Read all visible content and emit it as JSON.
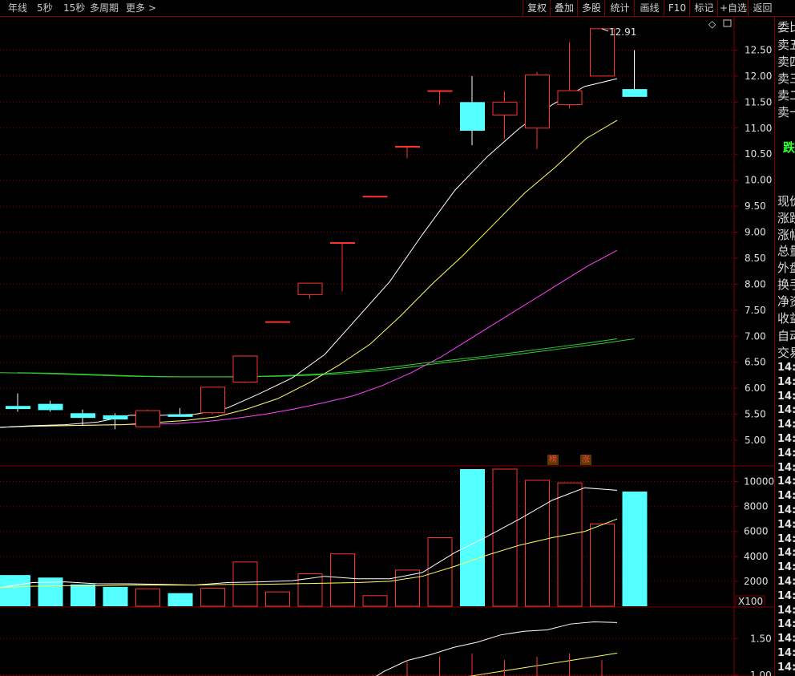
{
  "toolbar": {
    "left_tabs": [
      "年线",
      "5秒",
      "15秒",
      "多周期",
      "更多 >"
    ],
    "right_buttons": [
      "复权",
      "叠加",
      "多股",
      "统计",
      "画线",
      "F10",
      "标记",
      "+自选",
      "返回"
    ]
  },
  "right_panel": {
    "labels": [
      "委比",
      "卖五",
      "卖四",
      "卖三",
      "卖二",
      "卖一"
    ],
    "status": "跌",
    "stats": [
      "现价",
      "涨跌",
      "涨幅",
      "总量",
      "外盘",
      "换手",
      "净资",
      "收益"
    ],
    "extra": [
      "自动",
      "交易"
    ],
    "times": [
      "14:",
      "14:",
      "14:",
      "14:",
      "14:",
      "14:",
      "14:",
      "14:",
      "14:",
      "14:",
      "14:",
      "14:",
      "14:",
      "14:",
      "14:",
      "14:",
      "14:",
      "14:",
      "14:",
      "14:",
      "14:",
      "14:",
      "14:"
    ]
  },
  "badges": [
    "榜",
    "涨"
  ],
  "colors": {
    "up": "#ff3232",
    "down": "#54ffff",
    "ma5": "#ffffff",
    "ma10": "#ffff66",
    "ma20": "#ff44ff",
    "ma60": "#33cc33",
    "grid": "#800000"
  },
  "chart_data": [
    {
      "type": "candlestick",
      "ylim": [
        4.6,
        13.0
      ],
      "yticks": [
        "12.50",
        "12.00",
        "11.50",
        "11.00",
        "10.50",
        "10.00",
        "9.50",
        "9.00",
        "8.50",
        "8.00",
        "7.50",
        "7.00",
        "6.50",
        "6.00",
        "5.50",
        "5.00"
      ],
      "max_label": "12.91",
      "candles": [
        {
          "o": 5.66,
          "h": 5.9,
          "l": 5.55,
          "c": 5.6
        },
        {
          "o": 5.7,
          "h": 5.76,
          "l": 5.55,
          "c": 5.58
        },
        {
          "o": 5.52,
          "h": 5.59,
          "l": 5.28,
          "c": 5.43
        },
        {
          "o": 5.48,
          "h": 5.52,
          "l": 5.21,
          "c": 5.4
        },
        {
          "o": 5.26,
          "h": 5.59,
          "l": 5.26,
          "c": 5.57
        },
        {
          "o": 5.5,
          "h": 5.62,
          "l": 5.45,
          "c": 5.45
        },
        {
          "o": 5.53,
          "h": 6.02,
          "l": 5.5,
          "c": 6.02
        },
        {
          "o": 6.12,
          "h": 6.62,
          "l": 6.1,
          "c": 6.62
        },
        {
          "o": 7.28,
          "h": 7.28,
          "l": 7.28,
          "c": 7.28
        },
        {
          "o": 7.8,
          "h": 8.02,
          "l": 7.72,
          "c": 8.02
        },
        {
          "o": 8.8,
          "h": 8.8,
          "l": 7.86,
          "c": 8.8
        },
        {
          "o": 9.69,
          "h": 9.69,
          "l": 9.69,
          "c": 9.69
        },
        {
          "o": 10.65,
          "h": 10.65,
          "l": 10.42,
          "c": 10.65
        },
        {
          "o": 11.72,
          "h": 11.72,
          "l": 11.45,
          "c": 11.72
        },
        {
          "o": 11.5,
          "h": 12.0,
          "l": 10.67,
          "c": 10.95
        },
        {
          "o": 11.25,
          "h": 11.7,
          "l": 10.8,
          "c": 11.5
        },
        {
          "o": 11.0,
          "h": 12.08,
          "l": 10.6,
          "c": 12.02
        },
        {
          "o": 11.45,
          "h": 12.65,
          "l": 11.38,
          "c": 11.72
        },
        {
          "o": 12.0,
          "h": 12.91,
          "l": 12.0,
          "c": 12.91
        },
        {
          "o": 11.75,
          "h": 12.5,
          "l": 11.6,
          "c": 11.6
        }
      ],
      "ma5": [
        5.25,
        5.28,
        5.3,
        5.35,
        5.48,
        5.48,
        5.5,
        5.62,
        5.9,
        6.2,
        6.65,
        7.35,
        8.05,
        8.95,
        9.8,
        10.45,
        11.0,
        11.45,
        11.8,
        11.95
      ],
      "ma10": [
        5.25,
        5.27,
        5.28,
        5.29,
        5.3,
        5.34,
        5.38,
        5.45,
        5.6,
        5.8,
        6.1,
        6.45,
        6.85,
        7.4,
        8.0,
        8.55,
        9.15,
        9.75,
        10.25,
        10.8,
        11.15
      ],
      "ma20": [
        5.25,
        5.27,
        5.28,
        5.29,
        5.3,
        5.31,
        5.32,
        5.36,
        5.42,
        5.5,
        5.6,
        5.72,
        5.85,
        6.05,
        6.3,
        6.6,
        6.95,
        7.3,
        7.65,
        8.0,
        8.35,
        8.65
      ],
      "ma60": [
        6.3,
        6.29,
        6.27,
        6.25,
        6.23,
        6.22,
        6.22,
        6.22,
        6.23,
        6.25,
        6.28,
        6.33,
        6.4,
        6.48,
        6.55,
        6.62,
        6.7,
        6.78,
        6.86,
        6.95
      ]
    },
    {
      "type": "bar",
      "unit_label": "X100",
      "ylim": [
        0,
        11000
      ],
      "yticks": [
        "10000",
        "8000",
        "6000",
        "4000",
        "2000"
      ],
      "values": [
        2500,
        2300,
        1750,
        1550,
        1400,
        1050,
        1450,
        3550,
        1150,
        2600,
        4200,
        850,
        2900,
        5500,
        11000,
        11000,
        10100,
        9900,
        6600,
        9200
      ],
      "ma_a": [
        1500,
        1900,
        1950,
        1800,
        1800,
        1750,
        1700,
        1900,
        1950,
        2050,
        2400,
        2200,
        2200,
        2700,
        4300,
        5600,
        7000,
        8500,
        9500,
        9300
      ],
      "ma_b": [
        1500,
        1600,
        1650,
        1650,
        1700,
        1700,
        1700,
        1750,
        1750,
        1800,
        1850,
        1900,
        2000,
        2400,
        3200,
        4100,
        4900,
        5500,
        6000,
        7000
      ]
    },
    {
      "type": "line",
      "ylim": [
        0.8,
        1.9
      ],
      "yticks": [
        "1.50",
        "1.00"
      ],
      "line_a": [
        null,
        null,
        null,
        null,
        null,
        null,
        null,
        null,
        null,
        null,
        null,
        null,
        0.85,
        1.05,
        1.2,
        1.28,
        1.38,
        1.45,
        1.55,
        1.6,
        1.62,
        1.7,
        1.73,
        1.72
      ],
      "line_b": [
        null,
        null,
        null,
        null,
        null,
        null,
        null,
        null,
        null,
        null,
        null,
        null,
        null,
        null,
        null,
        0.9,
        0.95,
        1.0,
        1.05,
        1.1,
        1.15,
        1.2,
        1.25,
        1.3
      ]
    }
  ]
}
